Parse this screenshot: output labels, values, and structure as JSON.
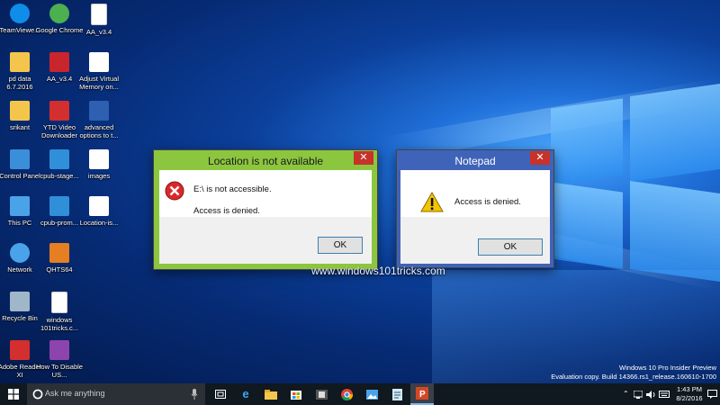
{
  "desktop_icons": [
    {
      "label": "TeamViewe...",
      "icon": "teamviewer-icon",
      "color": "#0e8ee9"
    },
    {
      "label": "Google Chrome",
      "icon": "chrome-icon",
      "color": "#4caf50"
    },
    {
      "label": "AA_v3.4",
      "icon": "document-icon",
      "color": "#ffffff"
    },
    {
      "label": "pd data 6.7.2016",
      "icon": "folder-icon",
      "color": "#f3c64b"
    },
    {
      "label": "AA_v3.4",
      "icon": "ammyy-icon",
      "color": "#c8252c"
    },
    {
      "label": "Adjust Virtual Memory on...",
      "icon": "shortcut-icon",
      "color": "#ffffff"
    },
    {
      "label": "srikant",
      "icon": "user-folder-icon",
      "color": "#f3c64b"
    },
    {
      "label": "YTD Video Downloader",
      "icon": "ytd-icon",
      "color": "#d32f2f"
    },
    {
      "label": "advanced options to t...",
      "icon": "image-file-icon",
      "color": "#2f5fb0"
    },
    {
      "label": "Control Panel",
      "icon": "control-panel-icon",
      "color": "#3a8fd8"
    },
    {
      "label": "cpub-stage...",
      "icon": "image-file-icon",
      "color": "#2f8fd8"
    },
    {
      "label": "images",
      "icon": "image-file-icon",
      "color": "#ffffff"
    },
    {
      "label": "This PC",
      "icon": "this-pc-icon",
      "color": "#4aa3e8"
    },
    {
      "label": "cpub-prom...",
      "icon": "image-file-icon",
      "color": "#2f8fd8"
    },
    {
      "label": "Location-is...",
      "icon": "image-file-icon",
      "color": "#ffffff"
    },
    {
      "label": "Network",
      "icon": "network-icon",
      "color": "#4aa3e8"
    },
    {
      "label": "QHTS64",
      "icon": "qhts-icon",
      "color": "#e67e22"
    },
    {
      "label": "Recycle Bin",
      "icon": "recycle-bin-icon",
      "color": "#9fb7c9"
    },
    {
      "label": "windows 101tricks.c...",
      "icon": "document-icon",
      "color": "#ffffff"
    },
    {
      "label": "Adobe Reader XI",
      "icon": "adobe-reader-icon",
      "color": "#d32f2f"
    },
    {
      "label": "How To Disable US...",
      "icon": "image-file-icon",
      "color": "#8e44ad"
    }
  ],
  "dialog_location": {
    "title": "Location is not available",
    "line1": "E:\\ is not accessible.",
    "line2": "Access is denied.",
    "ok_label": "OK",
    "close_label": "✕",
    "frame_color": "#8cc63f"
  },
  "dialog_notepad": {
    "title": "Notepad",
    "message": "Access is denied.",
    "ok_label": "OK",
    "close_label": "✕",
    "frame_color": "#3f63b8"
  },
  "watermark": "www.windows101tricks.com",
  "eval_notice": {
    "line1": "Windows 10 Pro Insider Preview",
    "line2": "Evaluation copy. Build 14366.rs1_release.160610-1700"
  },
  "taskbar": {
    "search_placeholder": "Ask me anything",
    "time": "1:43 PM",
    "date": "8/2/2016"
  }
}
